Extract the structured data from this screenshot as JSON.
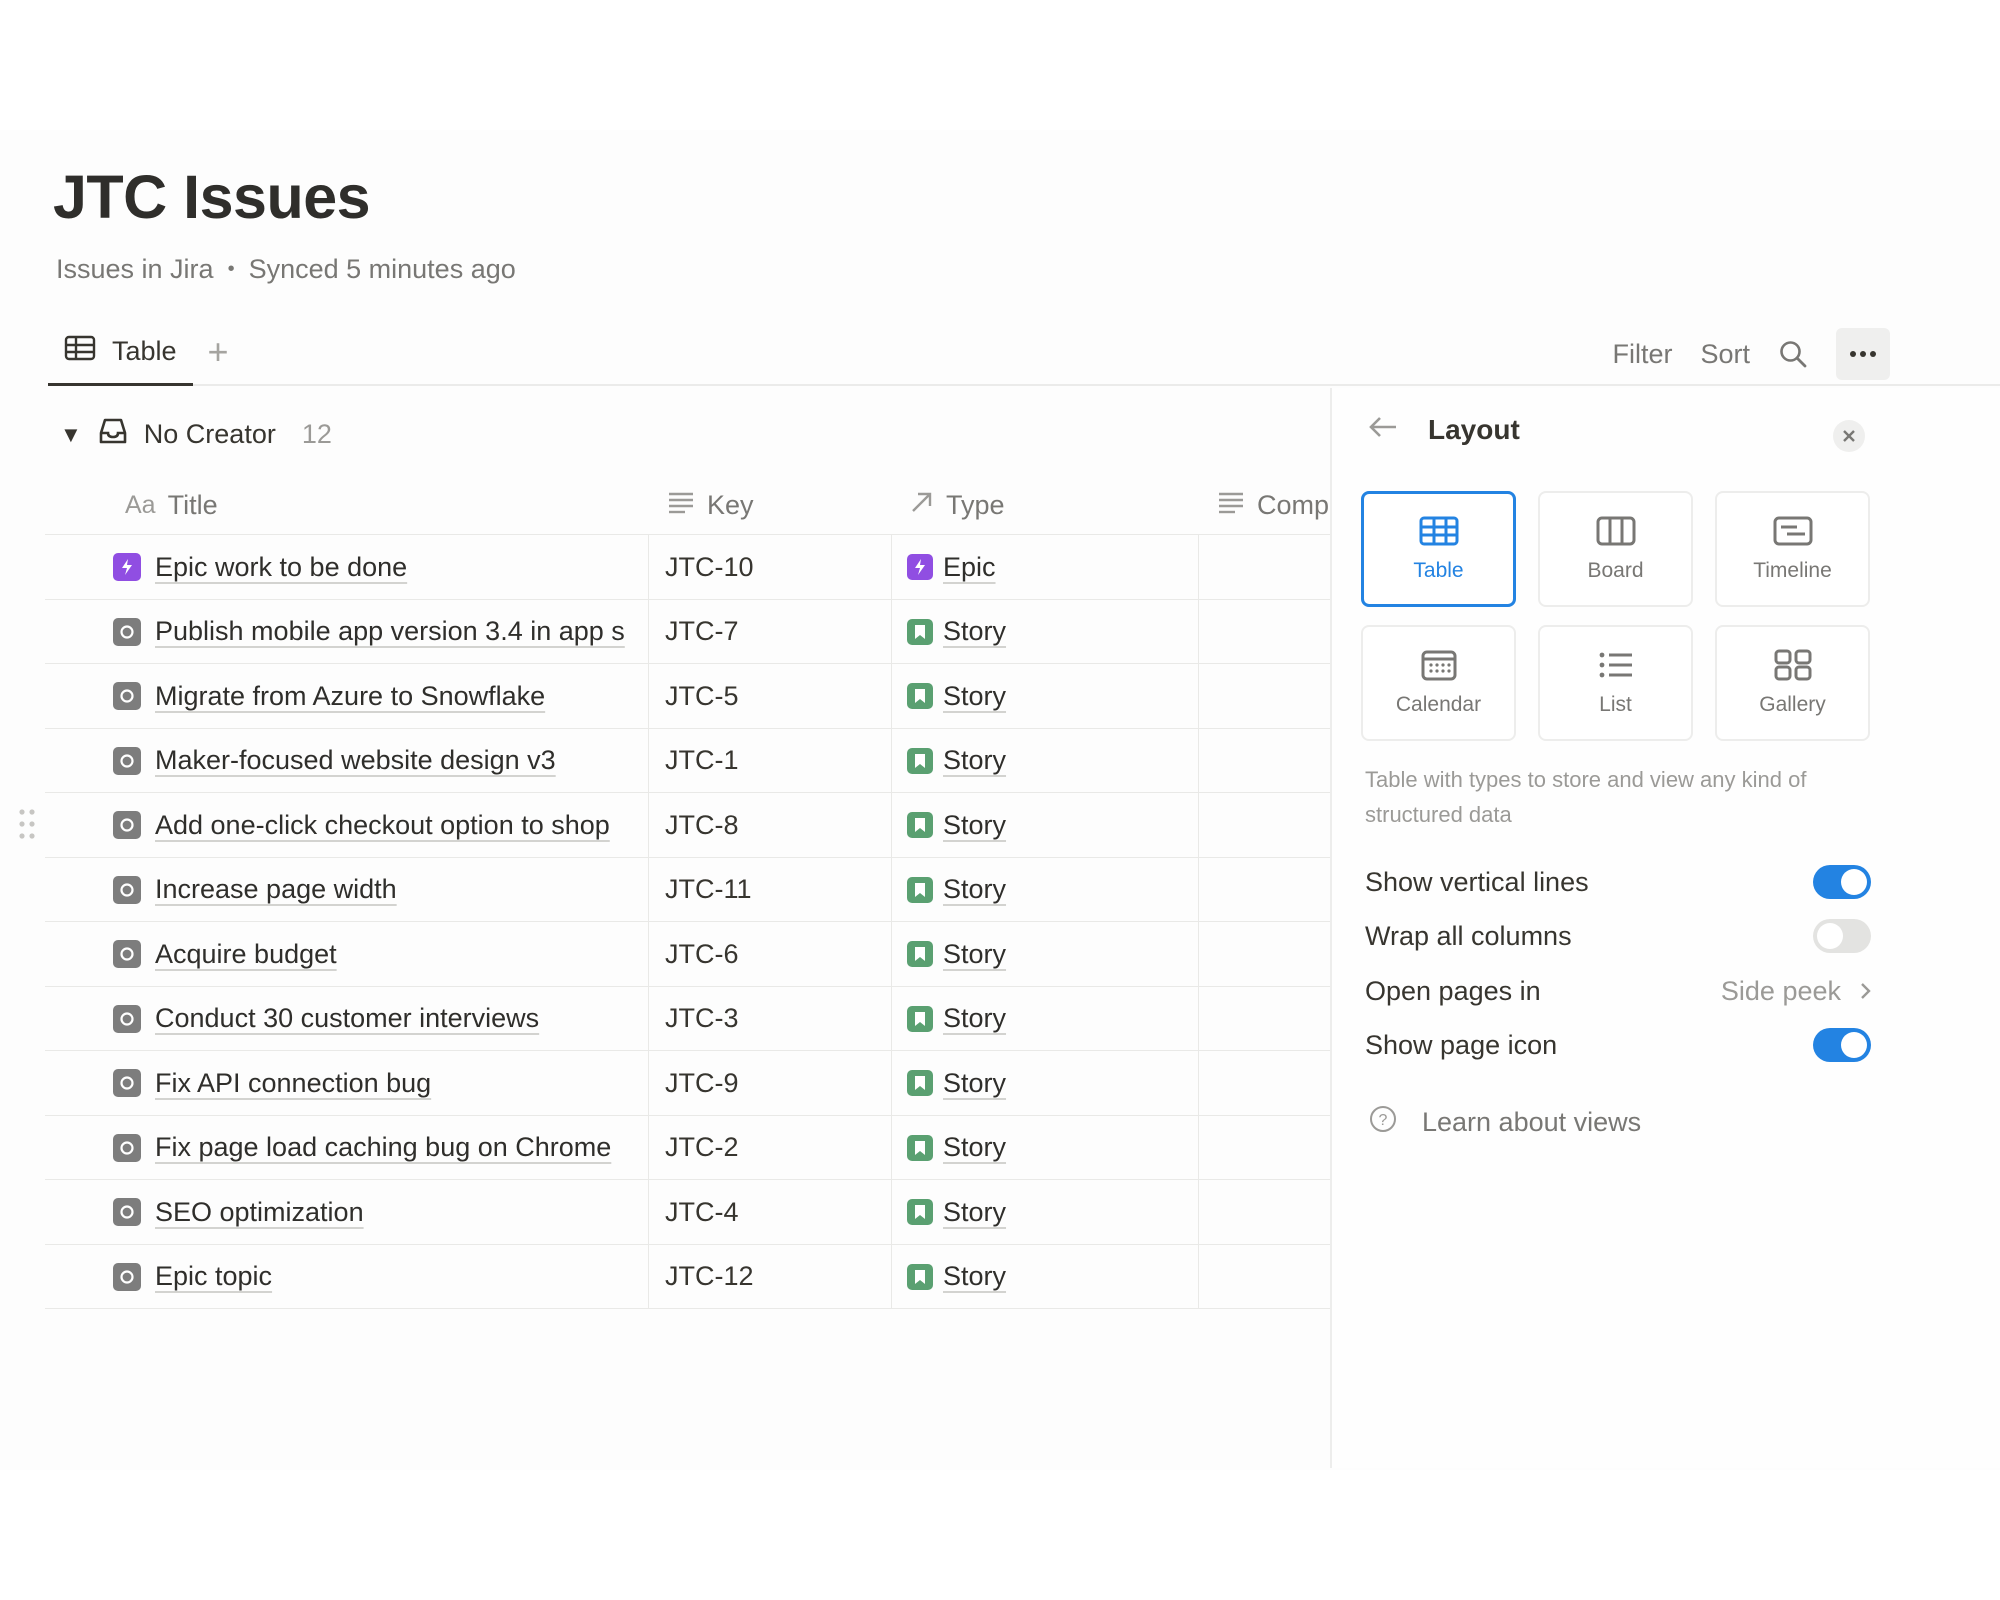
{
  "page": {
    "title": "JTC Issues",
    "source": "Issues in Jira",
    "separator": "•",
    "synced": "Synced 5 minutes ago"
  },
  "views": {
    "active_tab": "Table",
    "add_symbol": "+",
    "filter_label": "Filter",
    "sort_label": "Sort"
  },
  "group": {
    "name": "No Creator",
    "count": "12"
  },
  "table": {
    "columns": {
      "title_prefix": "Aa",
      "title": "Title",
      "key": "Key",
      "type": "Type",
      "comp": "Comp"
    },
    "rows": [
      {
        "title": "Epic work to be done",
        "key": "JTC-10",
        "type": "Epic",
        "icon": "epic"
      },
      {
        "title": "Publish mobile app version 3.4 in app s",
        "key": "JTC-7",
        "type": "Story",
        "icon": "story"
      },
      {
        "title": "Migrate from Azure to Snowflake",
        "key": "JTC-5",
        "type": "Story",
        "icon": "story"
      },
      {
        "title": "Maker-focused website design v3",
        "key": "JTC-1",
        "type": "Story",
        "icon": "story"
      },
      {
        "title": "Add one-click checkout option to shop",
        "key": "JTC-8",
        "type": "Story",
        "icon": "story"
      },
      {
        "title": "Increase page width",
        "key": "JTC-11",
        "type": "Story",
        "icon": "story"
      },
      {
        "title": "Acquire budget",
        "key": "JTC-6",
        "type": "Story",
        "icon": "story"
      },
      {
        "title": "Conduct 30 customer interviews",
        "key": "JTC-3",
        "type": "Story",
        "icon": "story"
      },
      {
        "title": "Fix API connection bug",
        "key": "JTC-9",
        "type": "Story",
        "icon": "story"
      },
      {
        "title": "Fix page load caching bug on Chrome",
        "key": "JTC-2",
        "type": "Story",
        "icon": "story"
      },
      {
        "title": "SEO optimization",
        "key": "JTC-4",
        "type": "Story",
        "icon": "story"
      },
      {
        "title": "Epic topic",
        "key": "JTC-12",
        "type": "Story",
        "icon": "story"
      }
    ]
  },
  "panel": {
    "title": "Layout",
    "layouts": [
      {
        "label": "Table",
        "icon": "table-icon",
        "active": true
      },
      {
        "label": "Board",
        "icon": "board-icon",
        "active": false
      },
      {
        "label": "Timeline",
        "icon": "timeline-icon",
        "active": false
      },
      {
        "label": "Calendar",
        "icon": "calendar-icon",
        "active": false
      },
      {
        "label": "List",
        "icon": "list-icon",
        "active": false
      },
      {
        "label": "Gallery",
        "icon": "gallery-icon",
        "active": false
      }
    ],
    "description": "Table with types to store and view any kind of structured data",
    "options": {
      "vertical_lines": {
        "label": "Show vertical lines",
        "on": true
      },
      "wrap_columns": {
        "label": "Wrap all columns",
        "on": false
      },
      "open_pages": {
        "label": "Open pages in",
        "value": "Side peek"
      },
      "page_icon": {
        "label": "Show page icon",
        "on": true
      }
    },
    "learn": "Learn about views"
  },
  "colors": {
    "accent": "#2383e2",
    "epic": "#904ee2",
    "story": "#5aa071",
    "text": "#37352f",
    "muted": "#787774"
  }
}
